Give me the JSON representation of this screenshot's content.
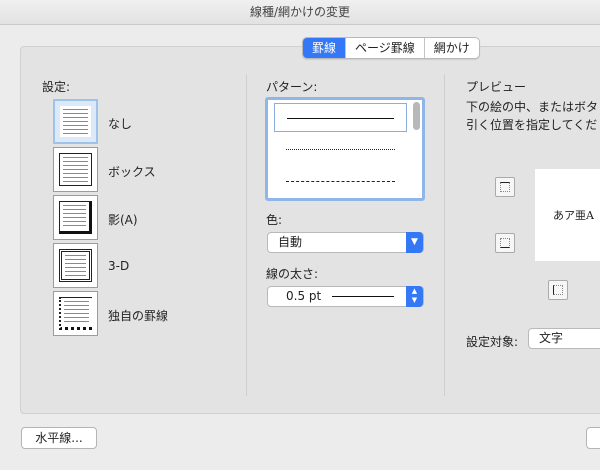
{
  "window": {
    "title": "線種/網かけの変更"
  },
  "tabs": [
    {
      "label": "罫線",
      "active": true
    },
    {
      "label": "ページ罫線",
      "active": false
    },
    {
      "label": "網かけ",
      "active": false
    }
  ],
  "settings": {
    "heading": "設定:",
    "items": [
      {
        "label": "なし",
        "selected": true
      },
      {
        "label": "ボックス",
        "selected": false
      },
      {
        "label": "影(A)",
        "selected": false
      },
      {
        "label": "3-D",
        "selected": false
      },
      {
        "label": "独自の罫線",
        "selected": false
      }
    ]
  },
  "pattern": {
    "heading": "パターン:",
    "options": [
      "solid",
      "dotted",
      "dashed"
    ]
  },
  "color": {
    "label": "色:",
    "value": "自動"
  },
  "width": {
    "label": "線の太さ:",
    "value": "0.5 pt"
  },
  "preview": {
    "heading": "プレビュー",
    "instruction_line1": "下の絵の中、またはボタ",
    "instruction_line2": "引く位置を指定してくだ",
    "sample_text": "あア亜A"
  },
  "apply_to": {
    "label": "設定対象:",
    "value": "文字"
  },
  "footer": {
    "horizontal_line_button": "水平線..."
  },
  "colors": {
    "accent": "#3478f6",
    "selected_bg": "#dce9f8"
  }
}
